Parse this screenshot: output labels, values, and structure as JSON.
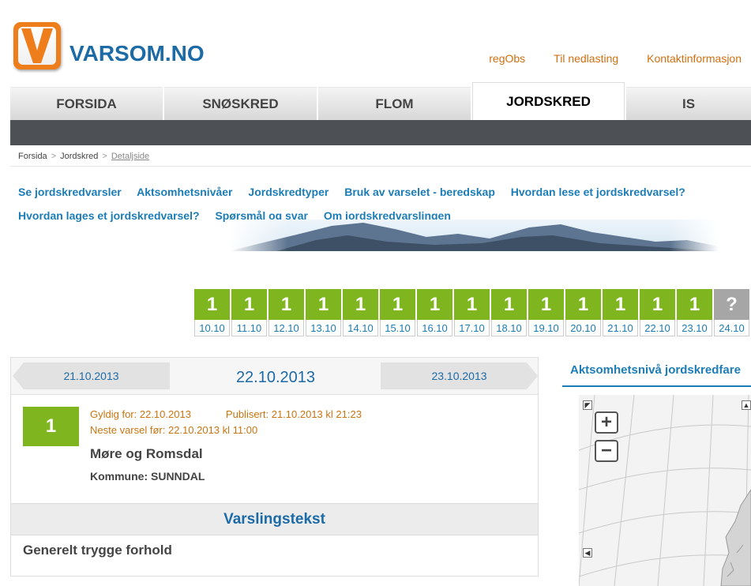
{
  "header": {
    "site_name": "VARSOM.NO",
    "top_links": [
      "regObs",
      "Til nedlasting",
      "Kontaktinformasjon"
    ]
  },
  "main_tabs": [
    {
      "label": "FORSIDA",
      "active": false
    },
    {
      "label": "SNØSKRED",
      "active": false
    },
    {
      "label": "FLOM",
      "active": false
    },
    {
      "label": "JORDSKRED",
      "active": true
    },
    {
      "label": "IS",
      "active": false
    }
  ],
  "breadcrumb": [
    "Forsida",
    "Jordskred",
    "Detaljside"
  ],
  "subnav": [
    "Se jordskredvarsler",
    "Aktsomhetsnivåer",
    "Jordskredtyper",
    "Bruk av varselet - beredskap",
    "Hvordan lese et jordskredvarsel?",
    "Hvordan lages et jordskredvarsel?",
    "Spørsmål og svar",
    "Om jordskredvarslingen"
  ],
  "days": [
    {
      "level": "1",
      "date": "10.10"
    },
    {
      "level": "1",
      "date": "11.10"
    },
    {
      "level": "1",
      "date": "12.10"
    },
    {
      "level": "1",
      "date": "13.10"
    },
    {
      "level": "1",
      "date": "14.10"
    },
    {
      "level": "1",
      "date": "15.10"
    },
    {
      "level": "1",
      "date": "16.10"
    },
    {
      "level": "1",
      "date": "17.10"
    },
    {
      "level": "1",
      "date": "18.10"
    },
    {
      "level": "1",
      "date": "19.10"
    },
    {
      "level": "1",
      "date": "20.10"
    },
    {
      "level": "1",
      "date": "21.10"
    },
    {
      "level": "1",
      "date": "22.10"
    },
    {
      "level": "1",
      "date": "23.10"
    },
    {
      "level": "?",
      "date": "24.10"
    }
  ],
  "forecast": {
    "prev_date": "21.10.2013",
    "current_date": "22.10.2013",
    "next_date": "23.10.2013",
    "level": "1",
    "valid_for": "Gyldig for: 22.10.2013",
    "published": "Publisert: 21.10.2013 kl 21:23",
    "next_forecast": "Neste varsel før: 22.10.2013 kl 11:00",
    "region": "Møre og Romsdal",
    "kommune": "Kommune: SUNNDAL",
    "warning_heading": "Varslingstekst",
    "warning_text": "Generelt trygge forhold"
  },
  "map": {
    "title": "Aktsomhetsnivå jordskredfare",
    "zoom_in": "+",
    "zoom_out": "−"
  },
  "colors": {
    "brand_blue": "#1c6aa6",
    "link_blue": "#1c7cb6",
    "orange": "#d06f10",
    "level_green": "#7fb51e",
    "unknown_grey": "#a6a6a6"
  }
}
